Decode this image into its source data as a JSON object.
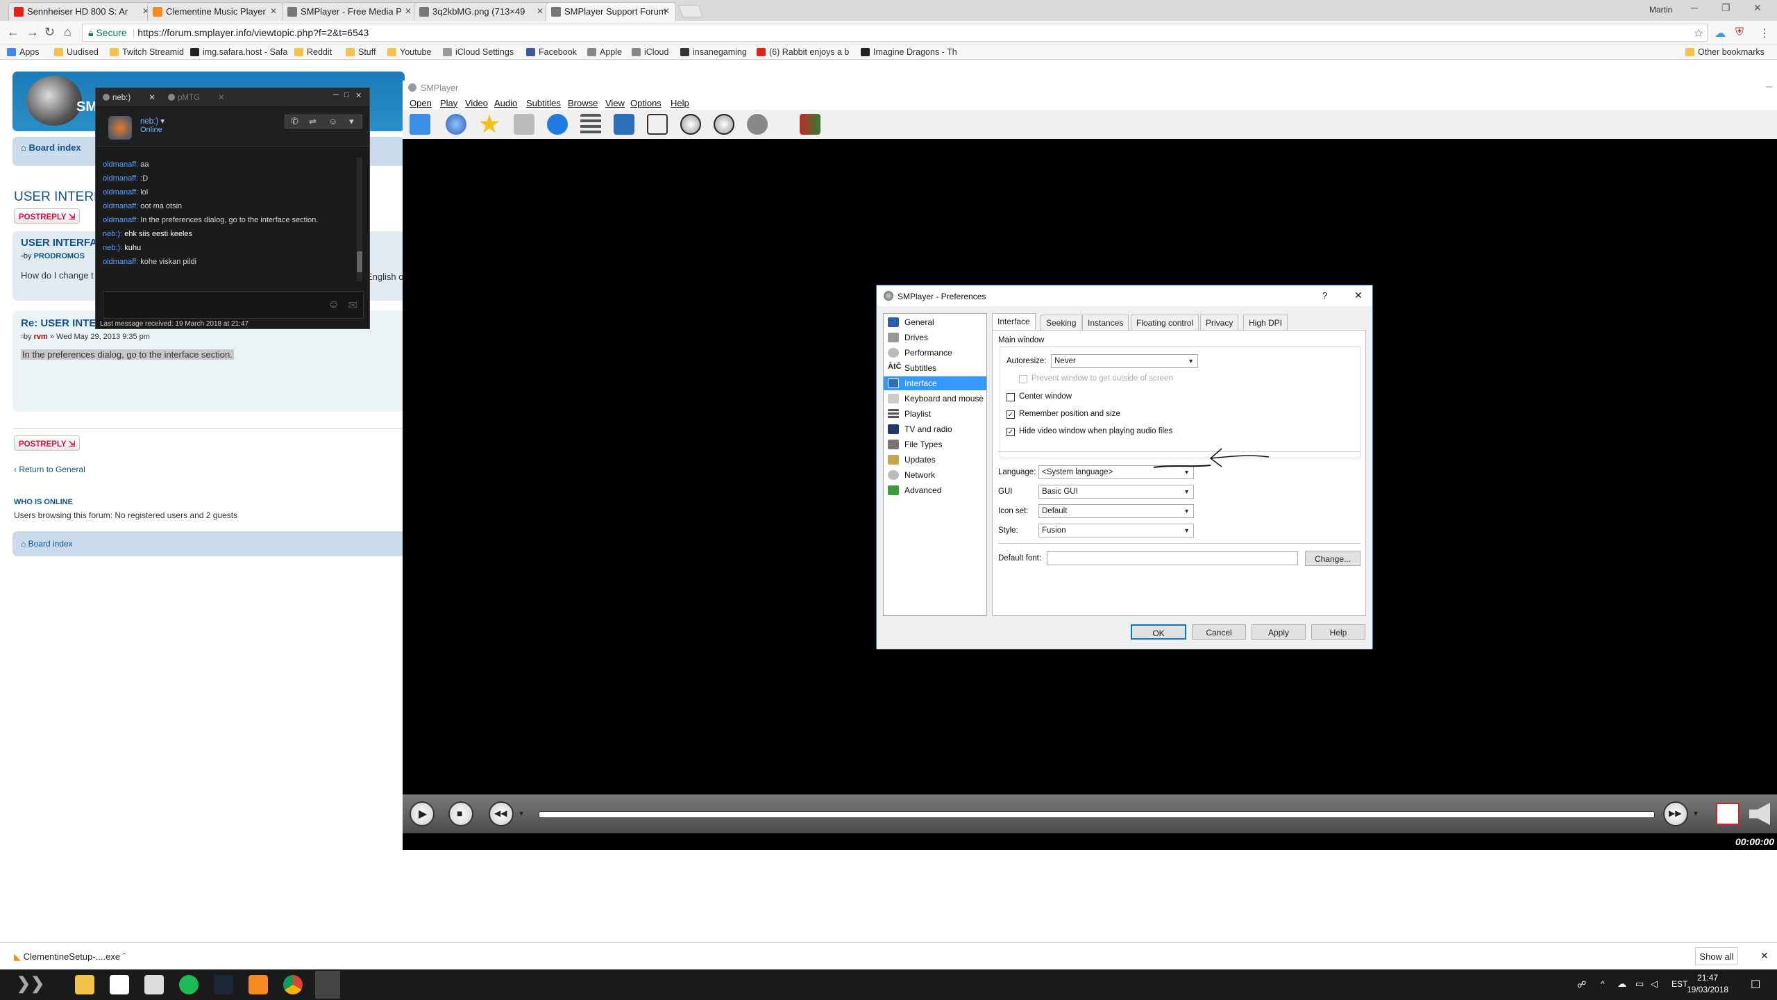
{
  "browser": {
    "tabs": [
      {
        "label": "Sennheiser HD 800 S: Ar",
        "color": "#e62117"
      },
      {
        "label": "Clementine Music Player",
        "color": "#f58a1f"
      },
      {
        "label": "SMPlayer - Free Media P",
        "color": "#777777"
      },
      {
        "label": "3q2kbMG.png (713×49",
        "color": "#777777"
      },
      {
        "label": "SMPlayer Support Forum",
        "color": "#777777"
      }
    ],
    "user": "Martin",
    "address": {
      "secure_label": "Secure",
      "url": "https://forum.smplayer.info/viewtopic.php?f=2&t=6543"
    },
    "bookmarks": [
      {
        "label": "Apps"
      },
      {
        "label": "Uudised"
      },
      {
        "label": "Twitch Streamid"
      },
      {
        "label": "img.safara.host - Safa"
      },
      {
        "label": "Reddit"
      },
      {
        "label": "Stuff"
      },
      {
        "label": "Youtube"
      },
      {
        "label": "iCloud Settings"
      },
      {
        "label": "Facebook"
      },
      {
        "label": "Apple"
      },
      {
        "label": "iCloud"
      },
      {
        "label": "insanegaming"
      },
      {
        "label": "(6) Rabbit enjoys a b"
      },
      {
        "label": "Imagine Dragons - Th"
      }
    ],
    "other_bookmarks": "Other bookmarks"
  },
  "forum": {
    "site_name": "SM",
    "breadcrumb": "Board index",
    "topic_title": "USER INTERFA",
    "post_reply": "POSTREPLY",
    "post1": {
      "title": "USER INTERFA",
      "author_prefix": "by",
      "author": "PRODROMOS",
      "body": "How do I change t",
      "body_tail": "English o"
    },
    "post2": {
      "title": "Re: USER INTER",
      "author_prefix": "by",
      "author": "rvm",
      "date": "» Wed May 29, 2013 9:35 pm",
      "body": "In the preferences dialog, go to the interface section."
    },
    "return_link": "Return to General",
    "who_is_online": "WHO IS ONLINE",
    "who_is_online_text": "Users browsing this forum: No registered users and 2 guests",
    "footer_board_index": "Board index"
  },
  "chat": {
    "tabs": [
      "neb:)",
      "pMTG"
    ],
    "user_name": "neb:)",
    "user_status": "Online",
    "messages": [
      {
        "who": "oldmanaff:",
        "text": "aa"
      },
      {
        "who": "oldmanaff:",
        "text": ":D"
      },
      {
        "who": "oldmanaff:",
        "text": "lol"
      },
      {
        "who": "oldmanaff:",
        "text": "oot ma otsin"
      },
      {
        "who": "oldmanaff:",
        "text": "In the preferences dialog, go to the interface section."
      },
      {
        "who": "neb:):",
        "text": "ehk siis eesti keeles"
      },
      {
        "who": "neb:):",
        "text": "kuhu"
      },
      {
        "who": "oldmanaff:",
        "text": "kohe viskan pildi"
      }
    ],
    "footer": "Last message received: 19 March 2018 at 21:47"
  },
  "smplayer": {
    "title": "SMPlayer",
    "menu": [
      "Open",
      "Play",
      "Video",
      "Audio",
      "Subtitles",
      "Browse",
      "View",
      "Options",
      "Help"
    ],
    "time": "00:00:00"
  },
  "prefs": {
    "title": "SMPlayer - Preferences",
    "help_glyph": "?",
    "categories": [
      "General",
      "Drives",
      "Performance",
      "Subtitles",
      "Interface",
      "Keyboard and mouse",
      "Playlist",
      "TV and radio",
      "File Types",
      "Updates",
      "Network",
      "Advanced"
    ],
    "selected_category": "Interface",
    "tabs": [
      "Interface",
      "Seeking",
      "Instances",
      "Floating control",
      "Privacy",
      "High DPI"
    ],
    "main_window": "Main window",
    "autoresize_label": "Autoresize:",
    "autoresize_value": "Never",
    "prevent_label": "Prevent window to get outside of screen",
    "center_label": "Center window",
    "remember_label": "Remember position and size",
    "hide_video_label": "Hide video window when playing audio files",
    "language_label": "Language:",
    "language_value": "<System language>",
    "gui_label": "GUI",
    "gui_value": "Basic GUI",
    "iconset_label": "Icon set:",
    "iconset_value": "Default",
    "style_label": "Style:",
    "style_value": "Fusion",
    "font_label": "Default font:",
    "font_value": "",
    "change_btn": "Change...",
    "ok": "OK",
    "cancel": "Cancel",
    "apply": "Apply",
    "help": "Help"
  },
  "download": {
    "file": "ClementineSetup-....exe",
    "show_all": "Show all"
  },
  "taskbar": {
    "lang": "EST",
    "time": "21:47",
    "date": "19/03/2018"
  }
}
